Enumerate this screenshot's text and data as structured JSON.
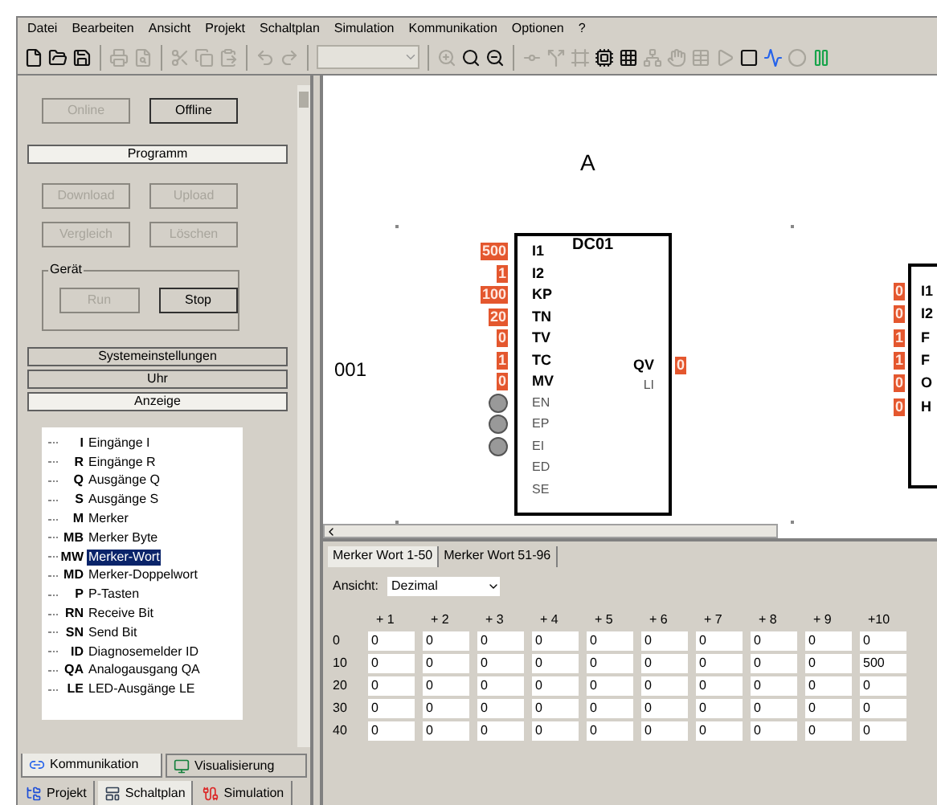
{
  "menu": [
    "Datei",
    "Bearbeiten",
    "Ansicht",
    "Projekt",
    "Schaltplan",
    "Simulation",
    "Kommunikation",
    "Optionen",
    "?"
  ],
  "toolbar": [
    {
      "kind": "new",
      "disabled": false
    },
    {
      "kind": "open",
      "disabled": false
    },
    {
      "kind": "save",
      "disabled": false
    },
    {
      "kind": "separator"
    },
    {
      "kind": "print",
      "disabled": true
    },
    {
      "kind": "preview",
      "disabled": true
    },
    {
      "kind": "separator"
    },
    {
      "kind": "cut",
      "disabled": true
    },
    {
      "kind": "copy",
      "disabled": true
    },
    {
      "kind": "paste",
      "disabled": true
    },
    {
      "kind": "separator"
    },
    {
      "kind": "undo",
      "disabled": true
    },
    {
      "kind": "redo",
      "disabled": true
    },
    {
      "kind": "separator"
    },
    {
      "kind": "combo",
      "disabled": true
    },
    {
      "kind": "separator"
    },
    {
      "kind": "zoomin",
      "disabled": true
    },
    {
      "kind": "zoomfit",
      "disabled": false
    },
    {
      "kind": "zoomout",
      "disabled": false
    },
    {
      "kind": "separator"
    },
    {
      "kind": "contact",
      "disabled": true
    },
    {
      "kind": "split",
      "disabled": true
    },
    {
      "kind": "frame",
      "disabled": true
    },
    {
      "kind": "chip",
      "disabled": false
    },
    {
      "kind": "grid",
      "disabled": false
    },
    {
      "kind": "network",
      "disabled": true
    },
    {
      "kind": "hand",
      "disabled": true
    },
    {
      "kind": "table",
      "disabled": true
    },
    {
      "kind": "play",
      "disabled": true
    },
    {
      "kind": "stop",
      "disabled": false
    },
    {
      "kind": "wave",
      "disabled": false
    },
    {
      "kind": "dot",
      "disabled": true
    },
    {
      "kind": "pause",
      "disabled": false
    }
  ],
  "sidebar": {
    "online_buttons": [
      {
        "label": "Online",
        "disabled": true
      },
      {
        "label": "Offline",
        "disabled": false
      }
    ],
    "sections": [
      {
        "kind": "bar",
        "label": "Programm",
        "expanded": true
      },
      {
        "kind": "buttons",
        "buttons": [
          {
            "label": "Download",
            "disabled": true
          },
          {
            "label": "Upload",
            "disabled": true
          },
          {
            "label": "Vergleich",
            "disabled": true
          },
          {
            "label": "Löschen",
            "disabled": true
          }
        ]
      },
      {
        "kind": "group",
        "title": "Gerät",
        "buttons": [
          {
            "label": "Run",
            "disabled": true
          },
          {
            "label": "Stop",
            "disabled": false
          }
        ]
      },
      {
        "kind": "bar",
        "label": "Systemeinstellungen",
        "expanded": false
      },
      {
        "kind": "bar",
        "label": "Uhr",
        "expanded": false
      },
      {
        "kind": "bar",
        "label": "Anzeige",
        "expanded": true
      }
    ],
    "tree": [
      {
        "code": "I",
        "label": "Eingänge I",
        "selected": false
      },
      {
        "code": "R",
        "label": "Eingänge R",
        "selected": false
      },
      {
        "code": "Q",
        "label": "Ausgänge Q",
        "selected": false
      },
      {
        "code": "S",
        "label": "Ausgänge S",
        "selected": false
      },
      {
        "code": "M",
        "label": "Merker",
        "selected": false
      },
      {
        "code": "MB",
        "label": "Merker Byte",
        "selected": false
      },
      {
        "code": "MW",
        "label": "Merker-Wort",
        "selected": true
      },
      {
        "code": "MD",
        "label": "Merker-Doppelwort",
        "selected": false
      },
      {
        "code": "P",
        "label": "P-Tasten",
        "selected": false
      },
      {
        "code": "RN",
        "label": "Receive Bit",
        "selected": false
      },
      {
        "code": "SN",
        "label": "Send Bit",
        "selected": false
      },
      {
        "code": "ID",
        "label": "Diagnosemelder ID",
        "selected": false
      },
      {
        "code": "QA",
        "label": "Analogausgang QA",
        "selected": false
      },
      {
        "code": "LE",
        "label": "LED-Ausgänge LE",
        "selected": false
      }
    ],
    "tabs": [
      {
        "label": "Kommunikation",
        "selected": true
      },
      {
        "label": "Visualisierung",
        "selected": false
      }
    ],
    "bottom_tabs": [
      {
        "label": "Projekt",
        "selected": false
      },
      {
        "label": "Schaltplan",
        "selected": true
      },
      {
        "label": "Simulation",
        "selected": false
      }
    ]
  },
  "canvas": {
    "column_label": "A",
    "row_label": "001",
    "block": {
      "title": "DC01",
      "inputs": [
        {
          "label": "I1",
          "value": "500",
          "kind": "param"
        },
        {
          "label": "I2",
          "value": "1",
          "kind": "param"
        },
        {
          "label": "KP",
          "value": "100",
          "kind": "param"
        },
        {
          "label": "TN",
          "value": "20",
          "kind": "param"
        },
        {
          "label": "TV",
          "value": "0",
          "kind": "param"
        },
        {
          "label": "TC",
          "value": "1",
          "kind": "param"
        },
        {
          "label": "MV",
          "value": "0",
          "kind": "param"
        },
        {
          "label": "EN",
          "kind": "enable"
        },
        {
          "label": "EP",
          "kind": "enable"
        },
        {
          "label": "EI",
          "kind": "enable"
        },
        {
          "label": "ED",
          "kind": "plain"
        },
        {
          "label": "SE",
          "kind": "plain"
        }
      ],
      "outputs": [
        {
          "label": "QV",
          "value": "0",
          "kind": "param"
        },
        {
          "label": "LI",
          "kind": "plain"
        }
      ]
    },
    "block2": {
      "inputs": [
        {
          "label": "I1",
          "value": "0"
        },
        {
          "label": "I2",
          "value": "0"
        },
        {
          "label": "F",
          "value": "1"
        },
        {
          "label": "F",
          "value": "1"
        },
        {
          "label": "O",
          "value": "0"
        },
        {
          "label": "H",
          "value": "0"
        }
      ]
    }
  },
  "panel": {
    "tabs": [
      {
        "label": "Merker Wort 1-50",
        "selected": true
      },
      {
        "label": "Merker Wort 51-96",
        "selected": false
      }
    ],
    "view_label": "Ansicht:",
    "view_value": "Dezimal",
    "columns": [
      "+ 1",
      "+ 2",
      "+ 3",
      "+ 4",
      "+ 5",
      "+ 6",
      "+ 7",
      "+ 8",
      "+ 9",
      "+10"
    ],
    "rows": [
      {
        "label": "0",
        "values": [
          "0",
          "0",
          "0",
          "0",
          "0",
          "0",
          "0",
          "0",
          "0",
          "0"
        ]
      },
      {
        "label": "10",
        "values": [
          "0",
          "0",
          "0",
          "0",
          "0",
          "0",
          "0",
          "0",
          "0",
          "500"
        ]
      },
      {
        "label": "20",
        "values": [
          "0",
          "0",
          "0",
          "0",
          "0",
          "0",
          "0",
          "0",
          "0",
          "0"
        ]
      },
      {
        "label": "30",
        "values": [
          "0",
          "0",
          "0",
          "0",
          "0",
          "0",
          "0",
          "0",
          "0",
          "0"
        ]
      },
      {
        "label": "40",
        "values": [
          "0",
          "0",
          "0",
          "0",
          "0",
          "0",
          "0",
          "0",
          "0",
          "0"
        ]
      }
    ]
  }
}
